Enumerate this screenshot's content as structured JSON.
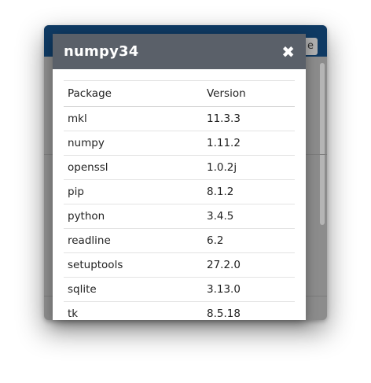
{
  "background": {
    "button_label": "e"
  },
  "modal": {
    "title": "numpy34",
    "close_label": "✖"
  },
  "table": {
    "headers": {
      "package": "Package",
      "version": "Version"
    },
    "rows": [
      {
        "package": "mkl",
        "version": "11.3.3"
      },
      {
        "package": "numpy",
        "version": "1.11.2"
      },
      {
        "package": "openssl",
        "version": "1.0.2j"
      },
      {
        "package": "pip",
        "version": "8.1.2"
      },
      {
        "package": "python",
        "version": "3.4.5"
      },
      {
        "package": "readline",
        "version": "6.2"
      },
      {
        "package": "setuptools",
        "version": "27.2.0"
      },
      {
        "package": "sqlite",
        "version": "3.13.0"
      },
      {
        "package": "tk",
        "version": "8.5.18"
      }
    ]
  },
  "colors": {
    "modal_header": "#5a6069",
    "app_header": "#0f3a63",
    "overlay": "#8c8c8c"
  }
}
